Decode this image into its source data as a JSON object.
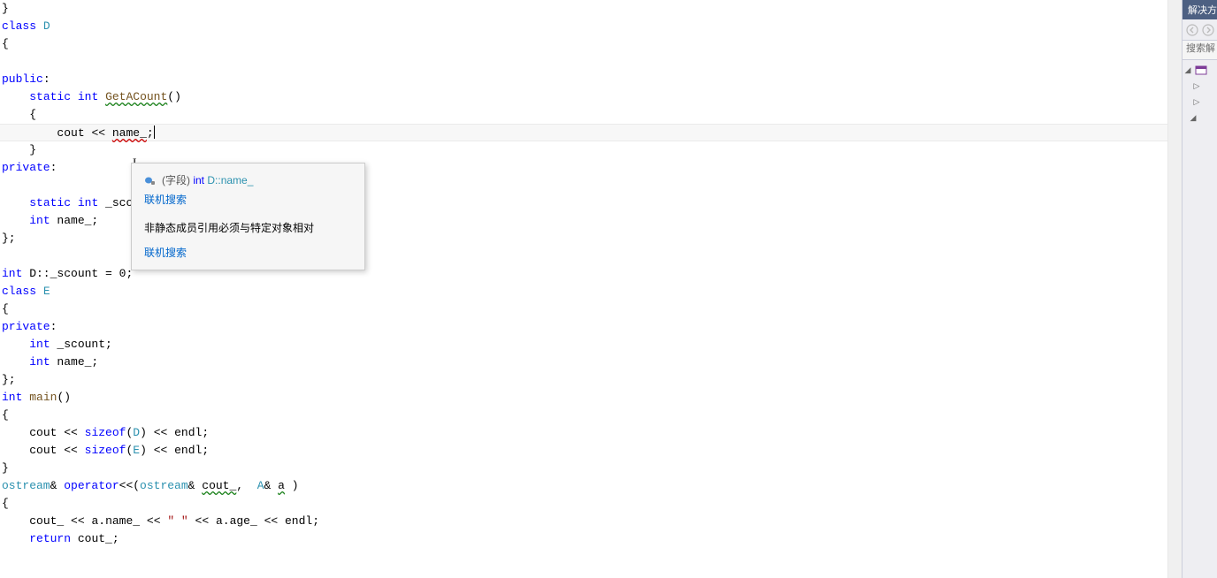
{
  "code": {
    "l1": "}",
    "l2_kw": "class",
    "l2_type": " D",
    "l3": "{",
    "l4": "",
    "l5_kw": "public",
    "l5_rest": ":",
    "l6_indent": "    ",
    "l6_kw": "static",
    "l6_sp": " ",
    "l6_kw2": "int",
    "l6_sp2": " ",
    "l6_func": "GetACount",
    "l6_rest": "()",
    "l7": "    {",
    "l8_indent": "        ",
    "l8_obj": "cout",
    "l8_mid": " << ",
    "l8_name": "name_",
    "l8_semi": ";",
    "l9": "    }",
    "l10_kw": "private",
    "l10_rest": ":",
    "l11": "",
    "l12_indent": "    ",
    "l12_kw": "static",
    "l12_sp": " ",
    "l12_kw2": "int",
    "l12_var": " _scount;",
    "l13_indent": "    ",
    "l13_kw": "int",
    "l13_var": " name_;",
    "l14": "};",
    "l15": "",
    "l16_kw": "int",
    "l16_mid": " D::_scount = ",
    "l16_num": "0",
    "l16_end": ";",
    "l17_kw": "class",
    "l17_type": " E",
    "l18": "{",
    "l19_kw": "private",
    "l19_rest": ":",
    "l20_indent": "    ",
    "l20_kw": "int",
    "l20_var": " _scount;",
    "l21_indent": "    ",
    "l21_kw": "int",
    "l21_var": " name_;",
    "l22": "};",
    "l23_kw": "int",
    "l23_sp": " ",
    "l23_func": "main",
    "l23_rest": "()",
    "l24": "{",
    "l25_indent": "    ",
    "l25_obj": "cout",
    "l25_a": " << ",
    "l25_kw": "sizeof",
    "l25_b": "(",
    "l25_type": "D",
    "l25_c": ") << ",
    "l25_obj2": "endl",
    "l25_d": ";",
    "l26_indent": "    ",
    "l26_obj": "cout",
    "l26_a": " << ",
    "l26_kw": "sizeof",
    "l26_b": "(",
    "l26_type": "E",
    "l26_c": ") << ",
    "l26_obj2": "endl",
    "l26_d": ";",
    "l27": "}",
    "l28_type": "ostream",
    "l28_a": "& ",
    "l28_kw": "operator",
    "l28_b": "<<(",
    "l28_type2": "ostream",
    "l28_c": "& ",
    "l28_var": "cout_",
    "l28_d": ",  ",
    "l28_type3": "A",
    "l28_e": "& ",
    "l28_var2": "a",
    "l28_f": " )",
    "l29": "{",
    "l30_indent": "    ",
    "l30_var": "cout_",
    "l30_a": " << ",
    "l30_var2": "a",
    "l30_b": ".",
    "l30_mem": "name_",
    "l30_c": " << ",
    "l30_str": "\" \"",
    "l30_d": " << ",
    "l30_var3": "a",
    "l30_e": ".",
    "l30_mem2": "age_",
    "l30_f": " << ",
    "l30_obj": "endl",
    "l30_g": ";",
    "l31_indent": "    ",
    "l31_kw": "return",
    "l31_sp": " ",
    "l31_var": "cout_",
    "l31_end": ";"
  },
  "tooltip": {
    "field_label": "(字段)",
    "field_type_kw": "int",
    "field_type": " D::name_",
    "link1": "联机搜索",
    "error_msg": "非静态成员引用必须与特定对象相对",
    "link2": "联机搜索"
  },
  "sidebar": {
    "title": "解决方",
    "nav_back": "‹",
    "nav_fwd": "›",
    "search_placeholder": "搜索解"
  }
}
